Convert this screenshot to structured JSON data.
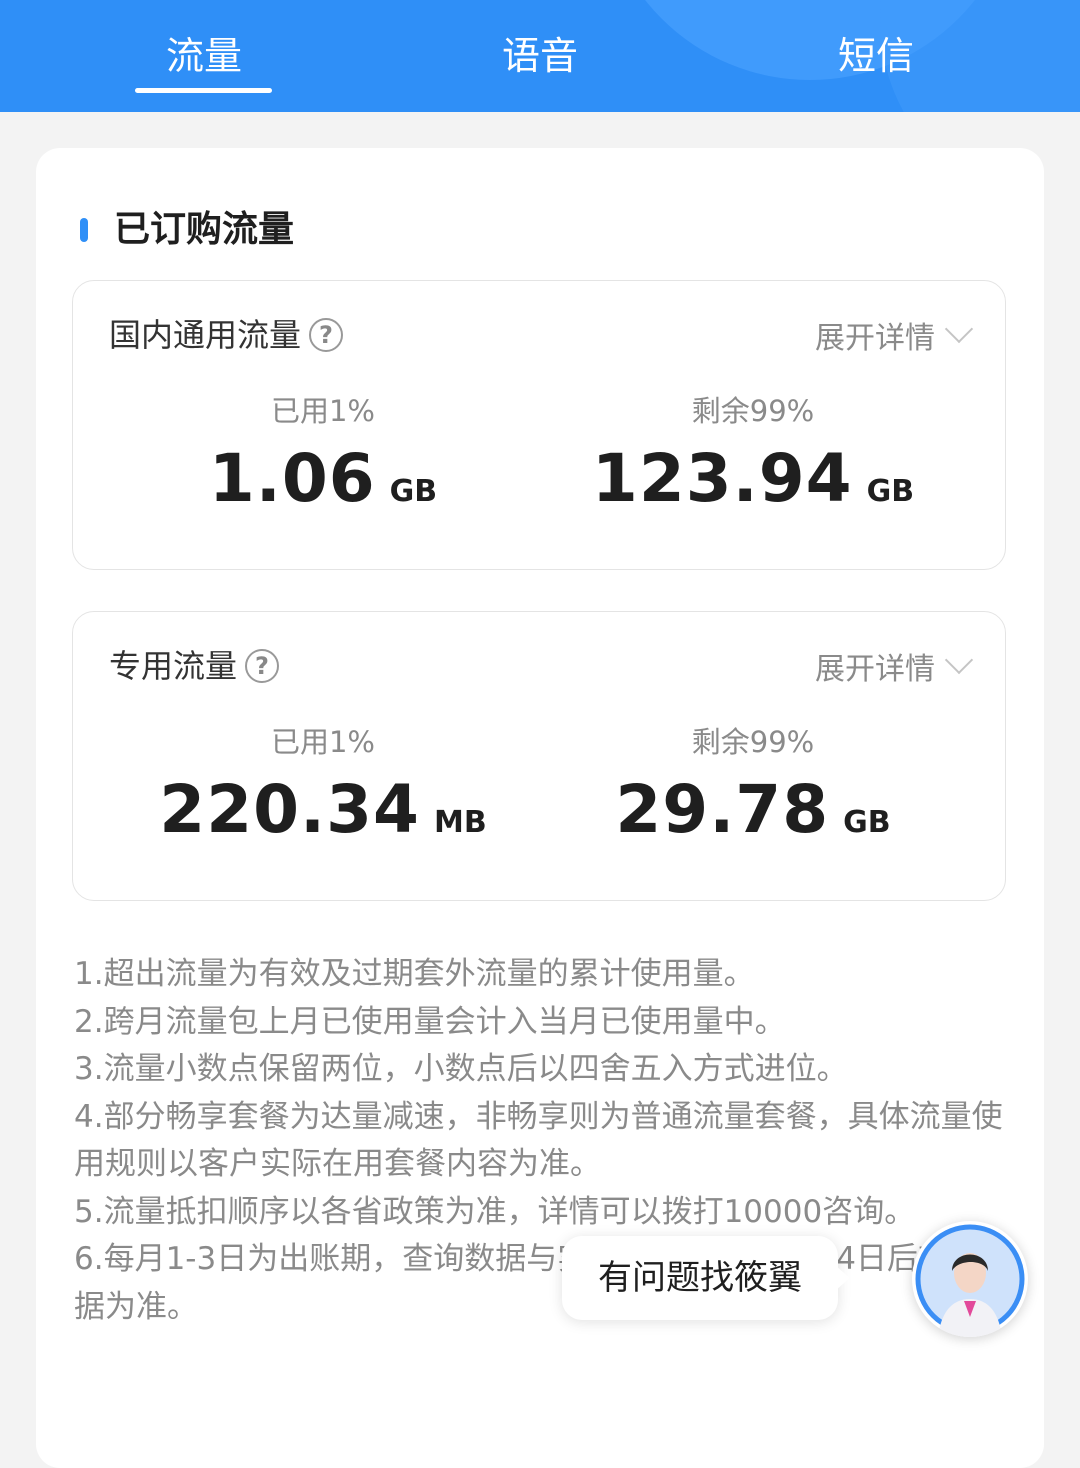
{
  "tabs": [
    {
      "label": "流量",
      "active": true
    },
    {
      "label": "语音",
      "active": false
    },
    {
      "label": "短信",
      "active": false
    }
  ],
  "section_title": "已订购流量",
  "boxes": [
    {
      "title": "国内通用流量",
      "expand": "展开详情",
      "used_label": "已用1%",
      "used_value": "1.06",
      "used_unit": "GB",
      "remain_label": "剩余99%",
      "remain_value": "123.94",
      "remain_unit": "GB"
    },
    {
      "title": "专用流量",
      "expand": "展开详情",
      "used_label": "已用1%",
      "used_value": "220.34",
      "used_unit": "MB",
      "remain_label": "剩余99%",
      "remain_value": "29.78",
      "remain_unit": "GB"
    }
  ],
  "notes": [
    "1.超出流量为有效及过期套外流量的累计使用量。",
    "2.跨月流量包上月已使用量会计入当月已使用量中。",
    "3.流量小数点保留两位，小数点后以四舍五入方式进位。",
    "4.部分畅享套餐为达量减速，非畅享则为普通流量套餐，具体流量使用规则以客户实际在用套餐内容为准。",
    "5.流量抵扣顺序以各省政策为准，详情可以拨打10000咨询。",
    "6.每月1-3日为出账期，查询数据与实际或有偏差，请以4日后查询数据为准。"
  ],
  "assistant": {
    "bubble": "有问题找筱翼"
  },
  "colors": {
    "primary": "#2f8ff7",
    "background": "#f3f3f3"
  }
}
